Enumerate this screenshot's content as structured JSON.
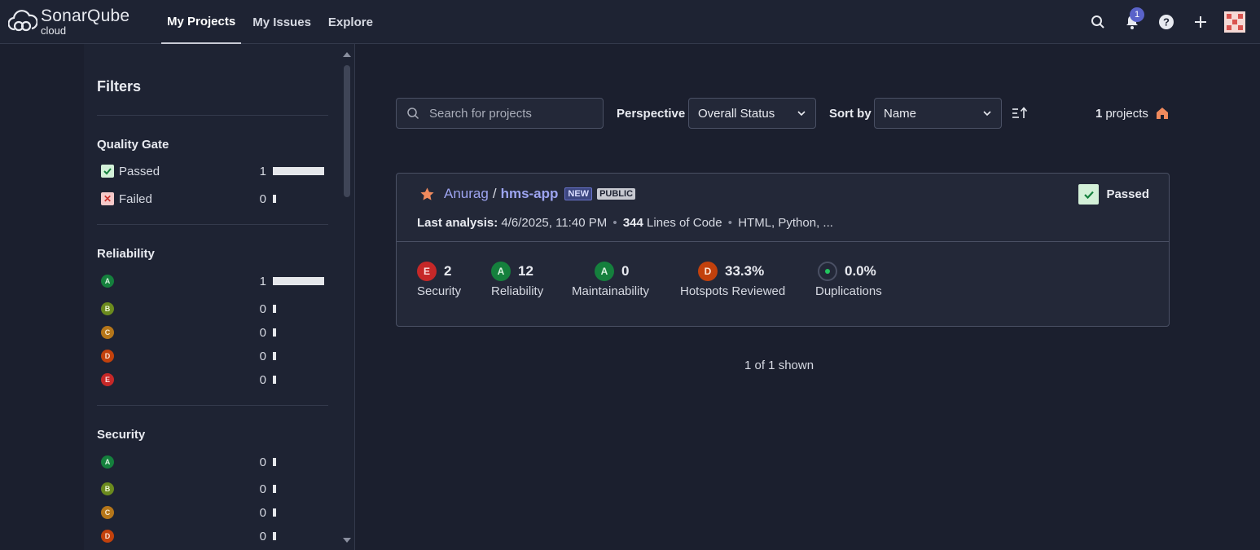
{
  "brand": {
    "name": "SonarQube",
    "sub": "cloud"
  },
  "nav": {
    "items": [
      "My Projects",
      "My Issues",
      "Explore"
    ]
  },
  "notifications": {
    "count": "1"
  },
  "sidebar": {
    "title": "Filters",
    "quality_gate": {
      "title": "Quality Gate",
      "rows": [
        {
          "label": "Passed",
          "count": "1",
          "fraction": 1
        },
        {
          "label": "Failed",
          "count": "0",
          "fraction": 0
        }
      ]
    },
    "reliability": {
      "title": "Reliability",
      "rows": [
        {
          "grade": "A",
          "count": "1",
          "fraction": 1
        },
        {
          "grade": "B",
          "count": "0",
          "fraction": 0
        },
        {
          "grade": "C",
          "count": "0",
          "fraction": 0
        },
        {
          "grade": "D",
          "count": "0",
          "fraction": 0
        },
        {
          "grade": "E",
          "count": "0",
          "fraction": 0
        }
      ]
    },
    "security": {
      "title": "Security",
      "rows": [
        {
          "grade": "A",
          "count": "0",
          "fraction": 0
        },
        {
          "grade": "B",
          "count": "0",
          "fraction": 0
        },
        {
          "grade": "C",
          "count": "0",
          "fraction": 0
        },
        {
          "grade": "D",
          "count": "0",
          "fraction": 0
        }
      ]
    }
  },
  "toolbar": {
    "search_placeholder": "Search for projects",
    "perspective_label": "Perspective",
    "perspective_value": "Overall Status",
    "sort_label": "Sort by",
    "sort_value": "Name",
    "count_number": "1",
    "count_suffix": "projects"
  },
  "project": {
    "org": "Anurag",
    "separator": "/",
    "key": "hms-app",
    "tag_new": "NEW",
    "tag_public": "PUBLIC",
    "quality_gate": "Passed",
    "analysis_label": "Last analysis:",
    "analysis_date": "4/6/2025, 11:40 PM",
    "loc_value": "344",
    "loc_label": "Lines of Code",
    "languages": "HTML, Python, ...",
    "metrics": [
      {
        "grade": "E",
        "value": "2",
        "label": "Security"
      },
      {
        "grade": "A",
        "value": "12",
        "label": "Reliability"
      },
      {
        "grade": "A",
        "value": "0",
        "label": "Maintainability"
      },
      {
        "grade": "D",
        "value": "33.3%",
        "label": "Hotspots Reviewed"
      },
      {
        "grade": "",
        "value": "0.0%",
        "label": "Duplications"
      }
    ]
  },
  "footer": {
    "shown": "1 of 1 shown"
  },
  "colors": {
    "accent": "#9da4f0",
    "passed": "#d3f0d8",
    "home": "#f08a5d"
  }
}
